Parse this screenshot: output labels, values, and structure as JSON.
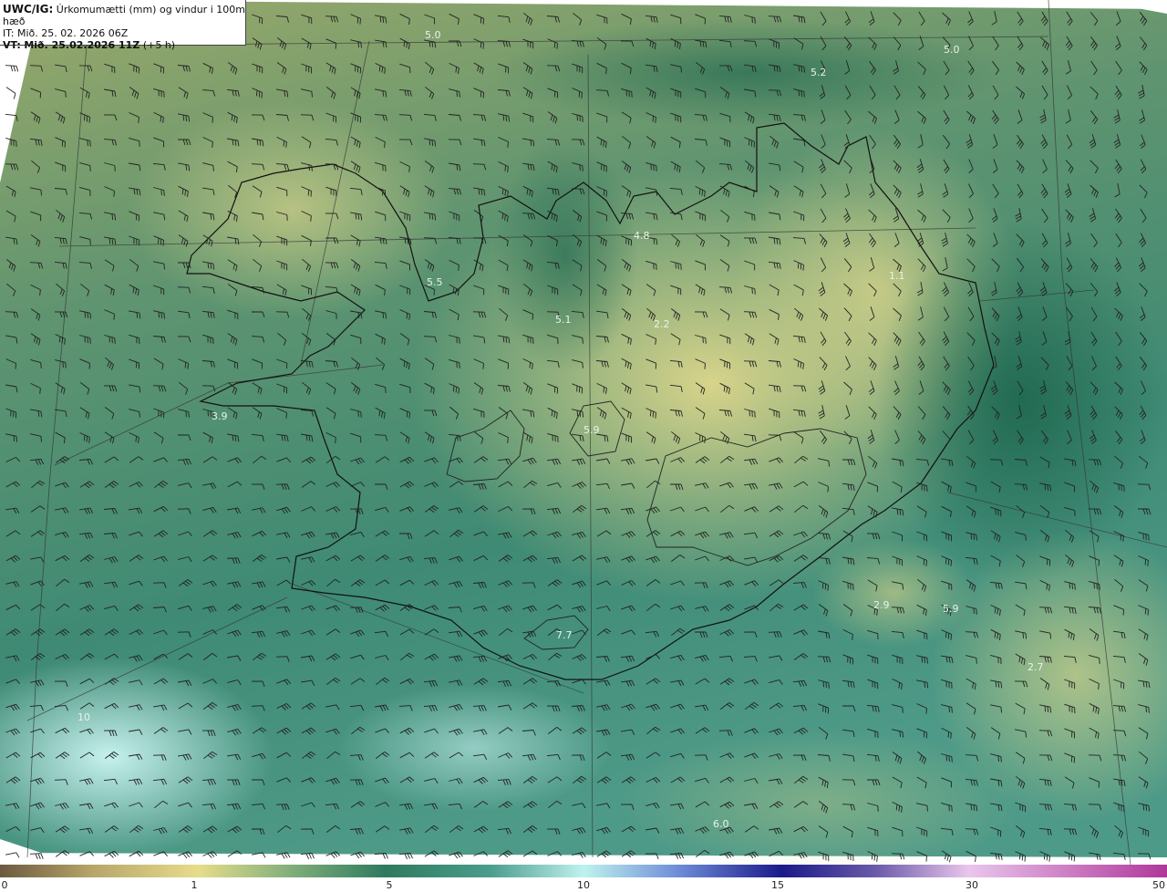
{
  "header": {
    "model": "UWC/IG:",
    "title": "Úrkomumætti (mm) og vindur i 100m hæð",
    "issue_time": "IT: Mið. 25. 02. 2026 06Z",
    "valid_time_label": "VT:",
    "valid_time": "Mið. 25.02.2026 11Z",
    "lead": "(+5 h)"
  },
  "labels": [
    {
      "text": "5.0"
    },
    {
      "text": "5.0"
    },
    {
      "text": "5.2"
    },
    {
      "text": "4.8"
    },
    {
      "text": "5.5"
    },
    {
      "text": "5.1"
    },
    {
      "text": "2.2"
    },
    {
      "text": "3.9"
    },
    {
      "text": "2.9"
    },
    {
      "text": "5.9"
    },
    {
      "text": "2.7"
    },
    {
      "text": "6.0"
    },
    {
      "text": "7.7"
    },
    {
      "text": "1.1"
    },
    {
      "text": "10"
    },
    {
      "text": "5.9"
    }
  ],
  "colorbar": {
    "ticks": [
      "0",
      "1",
      "5",
      "10",
      "15",
      "30",
      "50"
    ],
    "colors": {
      "dry": "#6b5a40",
      "low": "#e6dd8a",
      "mid": "#2f7a5e",
      "high": "#bff2ee",
      "very_high": "#1a1a8a",
      "extreme": "#d04fb8"
    }
  },
  "map_colors": {
    "land_yellow": "#c6c57a",
    "sea_green": "#2f7b60",
    "sea_teal": "#4e9a88",
    "light_teal": "#a7e0d8"
  }
}
